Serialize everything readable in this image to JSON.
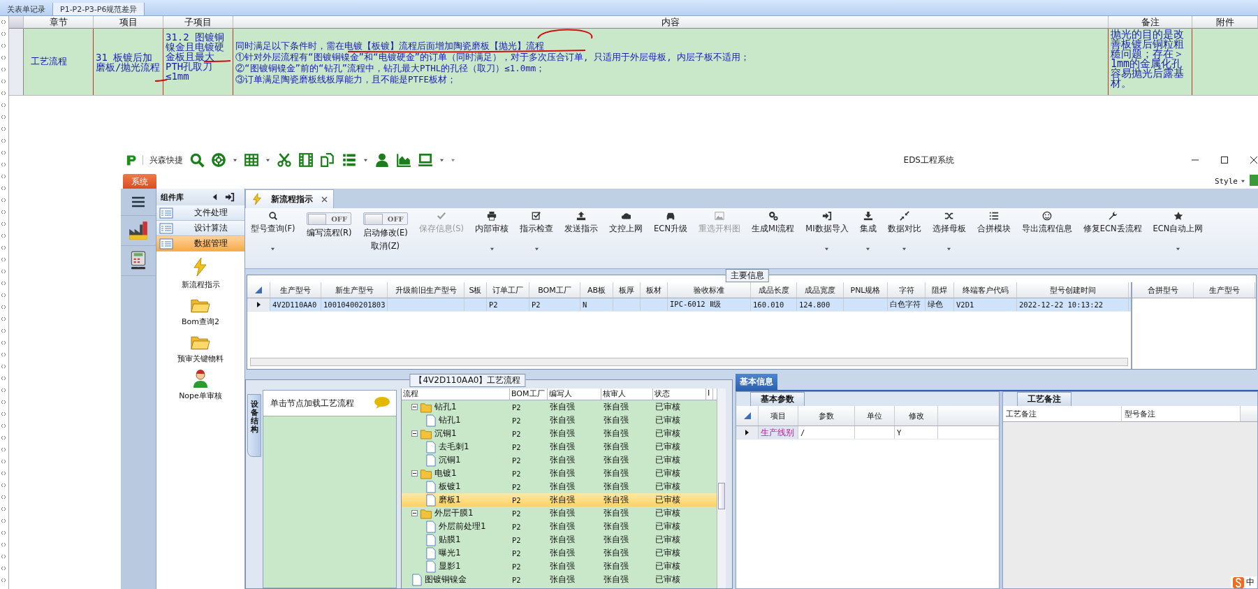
{
  "background_tabs": [
    {
      "label": "关表单记录",
      "selected": false
    },
    {
      "label": "P1-P2-P3-P6规范差异",
      "selected": true
    }
  ],
  "rule_table": {
    "columns": [
      "章节",
      "项目",
      "子项目",
      "内容",
      "备注",
      "附件"
    ],
    "rows": [
      {
        "chapter": "工艺流程",
        "item": "31 板镀后加磨板/抛光流程",
        "sub_item": "31.2 图镀铜镍金且电镀硬金板且最大PTH孔取刀≤1mm",
        "content": [
          "同时满足以下条件时，需在电镀【板镀】流程后面增加陶瓷磨板【抛光】流程",
          "①针对外层流程有“图镀铜镍金”和“电镀硬金”的订单（同时满足），对于多次压合订单, 只适用于外层母板, 内层子板不适用；",
          "②“图镀铜镍金”前的“钻孔”流程中，钻孔最大PTHL的孔径（取刀）≤1.0mm；",
          "③订单满足陶瓷磨板线板厚能力，且不能是PTFE板材；"
        ],
        "remark": "抛光的目的是改善板镀后铜粒粗糙问题；存在＞1mm的金属化孔容易抛光后露基材。"
      }
    ]
  },
  "app": {
    "brand": "兴森快捷",
    "title": "EDS工程系统",
    "style_label": "Style",
    "menu_tab": "系统",
    "sidebar": {
      "title": "组件库",
      "groups": [
        {
          "label": "文件处理",
          "selected": false
        },
        {
          "label": "设计算法",
          "selected": false
        },
        {
          "label": "数据管理",
          "selected": true
        }
      ],
      "tools": [
        {
          "label": "新流程指示"
        },
        {
          "label": "Bom查询2"
        },
        {
          "label": "预审关键物料"
        },
        {
          "label": "Nope单审核"
        }
      ]
    },
    "document_tab": {
      "label": "新流程指示"
    },
    "ribbon": [
      {
        "kind": "button",
        "label": "型号查询(F)",
        "dropdown": true,
        "disabled": false
      },
      {
        "kind": "toggle",
        "state": "OFF",
        "on": false,
        "label": "编写流程(R)"
      },
      {
        "kind": "toggle",
        "state": "OFF",
        "on": false,
        "label": "启动修改(E)",
        "sublabel": "取消(Z)"
      },
      {
        "kind": "button",
        "label": "保存信息(S)",
        "dropdown": false,
        "disabled": true
      },
      {
        "kind": "button",
        "label": "内部审核",
        "dropdown": true,
        "disabled": false
      },
      {
        "kind": "button",
        "label": "指示检查",
        "dropdown": true,
        "disabled": false
      },
      {
        "kind": "button",
        "label": "发送指示",
        "dropdown": false,
        "disabled": false
      },
      {
        "kind": "button",
        "label": "文控上网",
        "dropdown": false,
        "disabled": false
      },
      {
        "kind": "button",
        "label": "ECN升级",
        "dropdown": false,
        "disabled": false
      },
      {
        "kind": "button",
        "label": "重选开料图",
        "dropdown": false,
        "disabled": true
      },
      {
        "kind": "button",
        "label": "生成MI流程",
        "dropdown": false,
        "disabled": false
      },
      {
        "kind": "button",
        "label": "MI数据导入",
        "dropdown": true,
        "disabled": false
      },
      {
        "kind": "button",
        "label": "集成",
        "dropdown": true,
        "disabled": false
      },
      {
        "kind": "button",
        "label": "数据对比",
        "dropdown": true,
        "disabled": false
      },
      {
        "kind": "button",
        "label": "选择母板",
        "dropdown": true,
        "disabled": false
      },
      {
        "kind": "button",
        "label": "合拼模块",
        "dropdown": false,
        "disabled": false
      },
      {
        "kind": "button",
        "label": "导出流程信息",
        "dropdown": false,
        "disabled": false
      },
      {
        "kind": "button",
        "label": "修复ECN丢流程",
        "dropdown": false,
        "disabled": false
      },
      {
        "kind": "button",
        "label": "ECN自动上网",
        "dropdown": true,
        "disabled": false
      }
    ],
    "main_info": {
      "title": "主要信息",
      "columns": [
        "生产型号",
        "新生产型号",
        "升级前旧生产型号",
        "S板",
        "订单工厂",
        "BOM工厂",
        "AB板",
        "板厚",
        "板材",
        "验收标准",
        "成品长度",
        "成品宽度",
        "PNL规格",
        "字符",
        "阻焊",
        "终端客户代码",
        "型号创建时间"
      ],
      "rows": [
        {
          "selected": true,
          "cells": [
            "4V2D110AA0",
            "10010400201803",
            null,
            null,
            "P2",
            "P2",
            "N",
            null,
            null,
            "IPC-6012 Ⅱ级",
            "160.010",
            "124.800",
            null,
            "白色字符",
            "绿色",
            "V2D1",
            "2022-12-22 10:13:22"
          ]
        }
      ],
      "side_columns": [
        "合拼型号",
        "生产型号"
      ]
    },
    "process_panel": {
      "title": "【4V2D110AA0】工艺流程",
      "side_tab": "设备结构",
      "hint": "单击节点加载工艺流程",
      "columns": [
        "流程",
        "BOM工厂",
        "编写人",
        "核审人",
        "状态",
        "I"
      ],
      "tree": [
        {
          "name": "钻孔1",
          "bom": "P2",
          "writer": "张自强",
          "reviewer": "张自强",
          "status": "已审核",
          "selected": false,
          "children": [
            {
              "name": "钻孔1",
              "bom": "P2",
              "writer": "张自强",
              "reviewer": "张自强",
              "status": "已审核",
              "selected": false
            }
          ]
        },
        {
          "name": "沉铜1",
          "bom": "P2",
          "writer": "张自强",
          "reviewer": "张自强",
          "status": "已审核",
          "selected": false,
          "children": [
            {
              "name": "去毛刺1",
              "bom": "P2",
              "writer": "张自强",
              "reviewer": "张自强",
              "status": "已审核",
              "selected": false
            },
            {
              "name": "沉铜1",
              "bom": "P2",
              "writer": "张自强",
              "reviewer": "张自强",
              "status": "已审核",
              "selected": false
            }
          ]
        },
        {
          "name": "电镀1",
          "bom": "P2",
          "writer": "张自强",
          "reviewer": "张自强",
          "status": "已审核",
          "selected": false,
          "children": [
            {
              "name": "板镀1",
              "bom": "P2",
              "writer": "张自强",
              "reviewer": "张自强",
              "status": "已审核",
              "selected": false
            },
            {
              "name": "磨板1",
              "bom": "P2",
              "writer": "张自强",
              "reviewer": "张自强",
              "status": "已审核",
              "selected": true
            }
          ]
        },
        {
          "name": "外层干膜1",
          "bom": "P2",
          "writer": "张自强",
          "reviewer": "张自强",
          "status": "已审核",
          "selected": false,
          "children": [
            {
              "name": "外层前处理1",
              "bom": "P2",
              "writer": "张自强",
              "reviewer": "张自强",
              "status": "已审核",
              "selected": false
            },
            {
              "name": "贴膜1",
              "bom": "P2",
              "writer": "张自强",
              "reviewer": "张自强",
              "status": "已审核",
              "selected": false
            },
            {
              "name": "曝光1",
              "bom": "P2",
              "writer": "张自强",
              "reviewer": "张自强",
              "status": "已审核",
              "selected": false
            },
            {
              "name": "显影1",
              "bom": "P2",
              "writer": "张自强",
              "reviewer": "张自强",
              "status": "已审核",
              "selected": false
            }
          ]
        },
        {
          "name": "图镀铜镍金",
          "bom": "P2",
          "writer": "张自强",
          "reviewer": "张自强",
          "status": "已审核",
          "selected": false
        }
      ]
    },
    "info_panel": {
      "tab": "基本信息",
      "params": {
        "title": "基本参数",
        "columns": [
          "项目",
          "参数",
          "单位",
          "修改"
        ],
        "rows": [
          {
            "cells": [
              "生产线别",
              "/",
              null,
              "Y"
            ]
          }
        ]
      },
      "notes": {
        "title": "工艺备注",
        "columns": [
          "工艺备注",
          "型号备注"
        ]
      }
    },
    "ime": {
      "label": "中"
    }
  }
}
